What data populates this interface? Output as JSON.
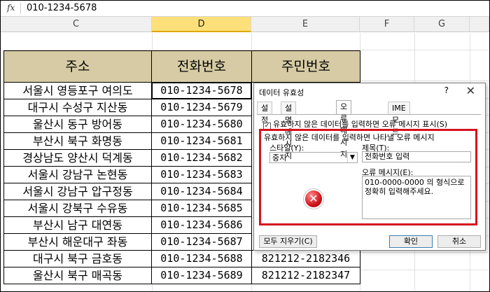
{
  "formula_bar": {
    "fx_label": "fx",
    "value": "010-1234-5678"
  },
  "columns": [
    "C",
    "D",
    "E",
    "F",
    "G"
  ],
  "selected_column": "D",
  "table": {
    "headers": [
      "주소",
      "전화번호",
      "주민번호"
    ],
    "rows": [
      {
        "addr": "서울시 영등포구 여의도",
        "phone": "010-1234-5678",
        "id": ""
      },
      {
        "addr": "대구시 수성구 지산동",
        "phone": "010-1234-5679",
        "id": ""
      },
      {
        "addr": "울산시 동구 방어동",
        "phone": "010-1234-5680",
        "id": ""
      },
      {
        "addr": "부산시 북구 화명동",
        "phone": "010-1234-5681",
        "id": ""
      },
      {
        "addr": "경상남도 양산시 덕계동",
        "phone": "010-1234-5682",
        "id": ""
      },
      {
        "addr": "서울시 강남구 논현동",
        "phone": "010-1234-5683",
        "id": ""
      },
      {
        "addr": "서울시 강남구 압구정동",
        "phone": "010-1234-5684",
        "id": ""
      },
      {
        "addr": "서울시 강북구 수유동",
        "phone": "010-1234-5685",
        "id": ""
      },
      {
        "addr": "부산시 남구 대연동",
        "phone": "010-1234-5686",
        "id": ""
      },
      {
        "addr": "부산시 해운대구 좌동",
        "phone": "010-1234-5687",
        "id": ""
      },
      {
        "addr": "대구시 북구 금호동",
        "phone": "010-1234-5688",
        "id": "821212-2182346"
      },
      {
        "addr": "울산시 북구 매곡동",
        "phone": "010-1234-5689",
        "id": "821212-2182347"
      }
    ]
  },
  "dialog": {
    "title": "데이터 유효성",
    "help": "?",
    "close": "✕",
    "tabs": [
      "설정",
      "설명 메시지",
      "오류 메시지",
      "IME 모드"
    ],
    "active_tab": "오류 메시지",
    "show_error_checkbox": "유효하지 않은 데이터를 입력하면 오류 메시지 표시(S)",
    "group_label": "유효하지 않은 데이터를 입력하면 나타낼 오류 메시지",
    "style_label": "스타일(Y):",
    "style_value": "중지",
    "title_label": "제목(T):",
    "title_value": "전화번호 입력",
    "message_label": "오류 메시지(E):",
    "message_value": "010-0000-0000 의 형식으로 정확히 입력해주세요.",
    "clear_all": "모두 지우기(C)",
    "ok": "확인",
    "cancel": "취소"
  },
  "colors": {
    "header_fill": "#d6cba4",
    "highlight_border": "#d6121e",
    "selected_column": "#fde07a"
  }
}
